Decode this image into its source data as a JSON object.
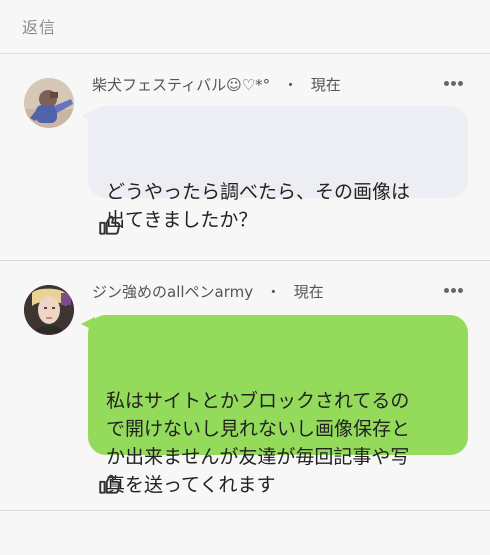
{
  "header": {
    "title": "返信"
  },
  "comments": [
    {
      "author": "柴犬フェスティバル☺♡*°",
      "separator": "・",
      "time": "現在",
      "text": "どうやったら調べたら、その画像は\n出てきましたか？",
      "bubble_color": "#eceef3",
      "avatar_icon": "user-avatar-photo",
      "like_icon": "thumbs-up-icon",
      "more_icon": "more-horizontal-icon"
    },
    {
      "author": "ジン強めのallペンarmy",
      "separator": "・",
      "time": "現在",
      "text": "私はサイトとかブロックされてるの\nで開けないし見れないし画像保存と\nか出来ませんが友達が毎回記事や写\n真を送ってくれます",
      "bubble_color": "#94db5c",
      "avatar_icon": "user-avatar-photo",
      "like_icon": "thumbs-up-icon",
      "more_icon": "more-horizontal-icon"
    }
  ]
}
